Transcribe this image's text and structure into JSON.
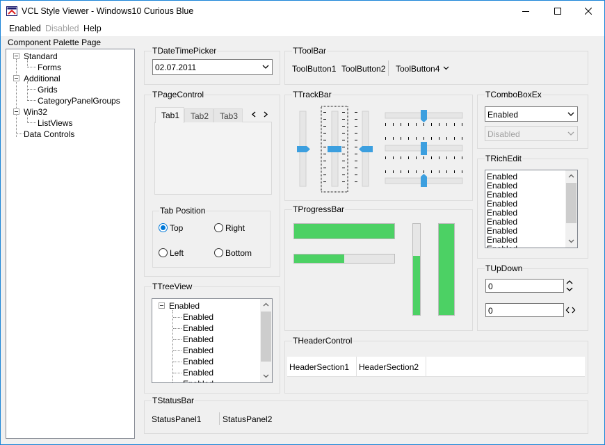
{
  "window": {
    "title": "VCL Style Viewer - Windows10 Curious Blue",
    "accent": "#1883d7"
  },
  "menu": {
    "enabled": "Enabled",
    "disabled": "Disabled",
    "help": "Help"
  },
  "palette": {
    "label": "Component Palette Page",
    "items": [
      "Standard",
      "Forms",
      "Additional",
      "Grids",
      "CategoryPanelGroups",
      "Win32",
      "ListViews",
      "Data Controls"
    ]
  },
  "datetime": {
    "group": "TDateTimePicker",
    "value": "02.07.2011"
  },
  "toolbar": {
    "group": "TToolBar",
    "buttons": [
      "ToolButton1",
      "ToolButton2",
      "ToolButton4"
    ]
  },
  "pagecontrol": {
    "group": "TPageControl",
    "tabs": [
      "Tab1",
      "Tab2",
      "Tab3"
    ],
    "tabpos": {
      "group": "Tab Position",
      "options": [
        "Top",
        "Right",
        "Left",
        "Bottom"
      ],
      "selected": "Top"
    }
  },
  "trackbar": {
    "group": "TTrackBar"
  },
  "comboboxex": {
    "group": "TComboBoxEx",
    "enabled_value": "Enabled",
    "disabled_value": "Disabled"
  },
  "richedit": {
    "group": "TRichEdit",
    "lines": [
      "Enabled",
      "Enabled",
      "Enabled",
      "Enabled",
      "Enabled",
      "Enabled",
      "Enabled",
      "Enabled",
      "Enabled"
    ]
  },
  "progressbar": {
    "group": "TProgressBar",
    "values": [
      1.0,
      0.5,
      0.65,
      1.0
    ],
    "color": "#4cd164"
  },
  "updown": {
    "group": "TUpDown",
    "values": [
      "0",
      "0"
    ]
  },
  "treeview": {
    "group": "TTreeView",
    "root": "Enabled",
    "children": [
      "Enabled",
      "Enabled",
      "Enabled",
      "Enabled",
      "Enabled",
      "Enabled",
      "Enabled"
    ]
  },
  "header": {
    "group": "THeaderControl",
    "sections": [
      "HeaderSection1",
      "HeaderSection2"
    ]
  },
  "statusbar": {
    "group": "TStatusBar",
    "panels": [
      "StatusPanel1",
      "StatusPanel2"
    ]
  }
}
